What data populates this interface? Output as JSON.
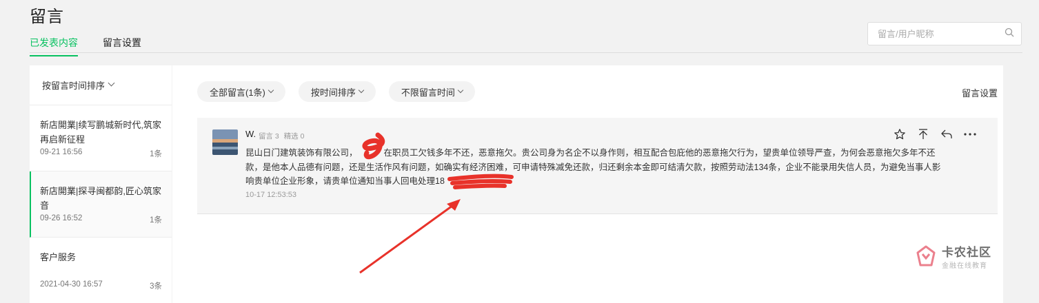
{
  "page": {
    "title": "留言"
  },
  "tabs": [
    {
      "label": "已发表内容",
      "active": true
    },
    {
      "label": "留言设置",
      "active": false
    }
  ],
  "search": {
    "placeholder": "留言/用户昵称",
    "icon": "search-icon"
  },
  "sidebar": {
    "sort_label": "按留言时间排序",
    "articles": [
      {
        "title": "新店開業|续写鹏城新时代,筑家再启新征程",
        "date": "09-21 16:56",
        "count": "1条",
        "active": false
      },
      {
        "title": "新店開業|探寻闽都韵,匠心筑家音",
        "date": "09-26 16:52",
        "count": "1条",
        "active": true
      },
      {
        "title": "客户服务",
        "date": "2021-04-30 16:57",
        "count": "3条",
        "active": false
      }
    ]
  },
  "filters": {
    "all": "全部留言(1条)",
    "sort": "按时间排序",
    "time": "不限留言时间",
    "settings_link": "留言设置"
  },
  "comment": {
    "nickname": "W.",
    "stats_comments": "留言 3",
    "stats_featured": "精选 0",
    "text_part1": "昆山日门建筑装饰有限公司，",
    "text_part2": "在职员工欠钱多年不还，恶意拖欠。贵公司身为名企不以身作则，相互配合包庇他的恶意拖欠行为，望贵单位领导严查，为何会恶意拖欠多年不还款，是他本人品德有问题，还是生活作风有问题，如确实有经济困难，可申请特殊减免还款，归还剩余本金即可结清欠款，按照劳动法134条，企业不能录用失信人员，为避免当事人影响贵单位企业形象，请贵单位通知当事人回电处理18",
    "time": "10-17 12:53:53",
    "actions": [
      "star-icon",
      "pin-top-icon",
      "reply-icon",
      "more-icon"
    ]
  },
  "watermark": {
    "name": "卡农社区",
    "tagline": "金融在线教育"
  },
  "colors": {
    "accent": "#07c160",
    "annotation_red": "#e8322a"
  }
}
